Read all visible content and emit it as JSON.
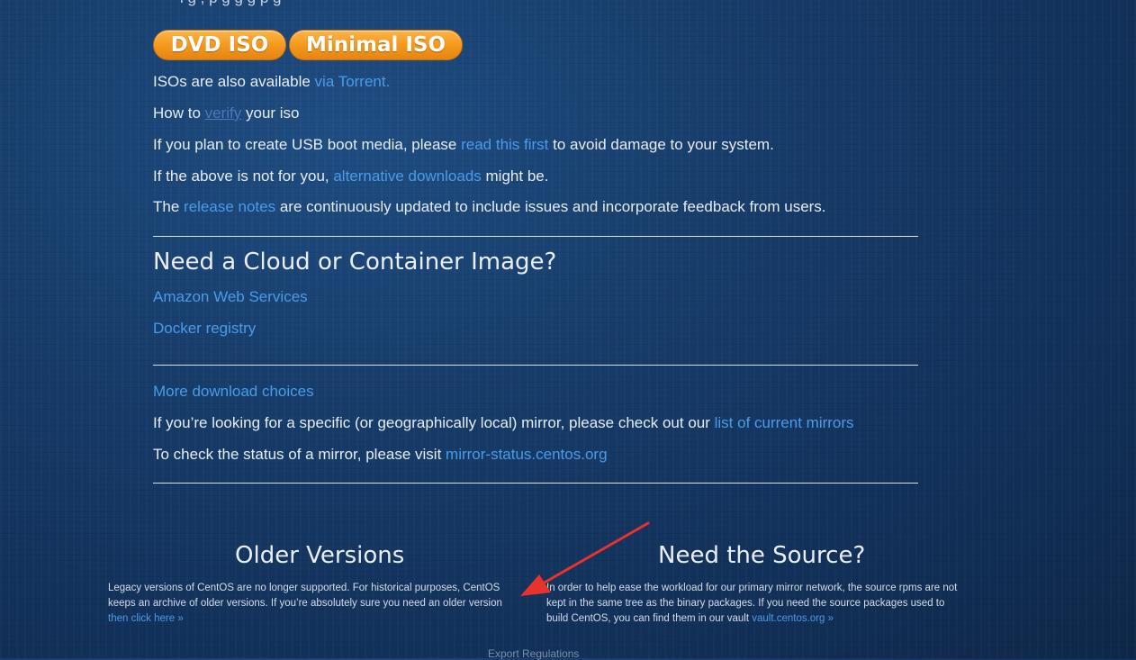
{
  "top_cut_text": "i   g     ,   p    g        g      g        p g",
  "iso_buttons": {
    "dvd": "DVD ISO",
    "minimal": "Minimal ISO"
  },
  "lines": {
    "torrent": {
      "pre": "ISOs are also available ",
      "link": "via Torrent."
    },
    "verify": {
      "pre": "How to ",
      "link": "verify",
      "post": " your iso"
    },
    "usb": {
      "pre": "If you plan to create USB boot media, please ",
      "link": "read this first",
      "post": " to avoid damage to your system."
    },
    "alternative": {
      "pre": "If the above is not for you, ",
      "link": "alternative downloads",
      "post": " might be."
    },
    "release": {
      "pre": "The ",
      "link": "release notes",
      "post": " are continuously updated to include issues and incorporate feedback from users."
    }
  },
  "cloud": {
    "heading": "Need a Cloud or Container Image?",
    "aws": "Amazon Web Services",
    "docker": "Docker registry"
  },
  "more": {
    "choices": "More download choices",
    "mirror_pre": "If you’re looking for a specific (or geographically local) mirror, please check out our ",
    "mirror_link": "list of current mirrors",
    "status_pre": "To check the status of a mirror, please visit ",
    "status_link": "mirror-status.centos.org"
  },
  "older": {
    "heading": "Older Versions",
    "text": "Legacy versions of CentOS are no longer supported. For historical purposes, CentOS keeps an archive of older versions. If you’re absolutely sure you need an older version ",
    "link": "then click here »"
  },
  "source": {
    "heading": "Need the Source?",
    "text": "In order to help ease the workload for our primary mirror network, the source rpms are not kept in the same tree as the binary packages. If you need the source packages used to build CentOS, you can find them in our vault ",
    "link": "vault.centos.org »"
  },
  "footer": "Export Regulations",
  "colors": {
    "link": "#4a9be8",
    "button": "#f49a1c",
    "arrow": "#e8322b",
    "background": "#173d6b"
  }
}
